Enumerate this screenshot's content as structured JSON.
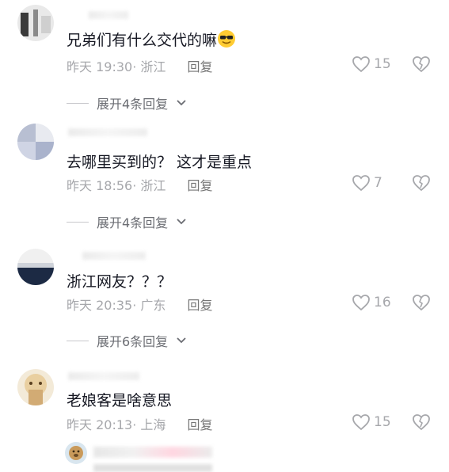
{
  "comments": [
    {
      "text": "兄弟们有什么交代的嘛",
      "time": "昨天 19:30",
      "location": "浙江",
      "reply_label": "回复",
      "likes": "15",
      "expand": "展开4条回复",
      "has_emoji": true,
      "emoji": "smiling-face-with-sunglasses"
    },
    {
      "text": "去哪里买到的？ 这才是重点",
      "time": "昨天 18:56",
      "location": "浙江",
      "reply_label": "回复",
      "likes": "7",
      "expand": "展开4条回复"
    },
    {
      "text": "浙江网友？？？",
      "time": "昨天 20:35",
      "location": "广东",
      "reply_label": "回复",
      "likes": "16",
      "expand": "展开6条回复"
    },
    {
      "text": "老娘客是啥意思",
      "time": "昨天 20:13",
      "location": "上海",
      "reply_label": "回复",
      "likes": "15"
    }
  ],
  "colors": {
    "text_primary": "#161823",
    "text_meta": "#a6a7ab",
    "reply": "#757575"
  }
}
